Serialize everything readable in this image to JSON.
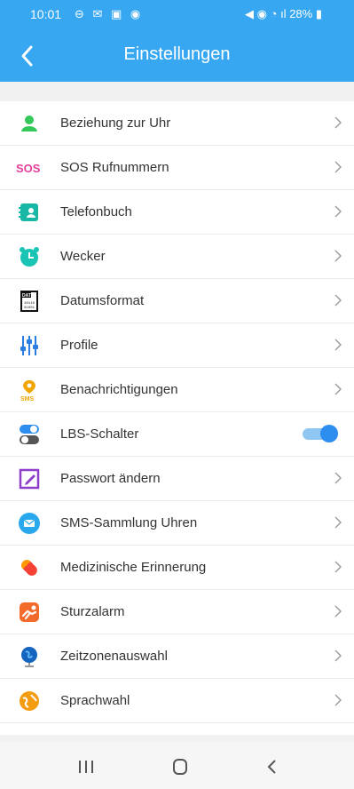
{
  "status": {
    "time": "10:01",
    "left_icons": "⊖ ✉ ▣ ◉",
    "right_icons": "◀ ◉ ◔ ıl",
    "battery": "28%"
  },
  "header": {
    "title": "Einstellungen",
    "back_icon": "back-arrow-icon"
  },
  "settings": [
    {
      "label": "Beziehung zur Uhr",
      "icon": "person-icon",
      "accent": "#34c759"
    },
    {
      "label": "SOS Rufnummern",
      "icon": "sos-icon",
      "accent": "#e53f9c",
      "icon_text": "SOS"
    },
    {
      "label": "Telefonbuch",
      "icon": "contacts-icon",
      "accent": "#19b8a6"
    },
    {
      "label": "Wecker",
      "icon": "alarm-clock-icon",
      "accent": "#19c4b4"
    },
    {
      "label": "Datumsformat",
      "icon": "date-format-icon",
      "accent": "#111111",
      "icon_text": "DAT"
    },
    {
      "label": "Profile",
      "icon": "equalizer-icon",
      "accent": "#2a7de1"
    },
    {
      "label": "Benachrichtigungen",
      "icon": "sms-location-icon",
      "accent": "#f0a500",
      "icon_text": "SMS"
    },
    {
      "label": "LBS-Schalter",
      "icon": "switch-icon",
      "accent": "#2d8ef0",
      "toggle_on": true
    },
    {
      "label": "Passwort ändern",
      "icon": "edit-icon",
      "accent": "#8e3ec9"
    },
    {
      "label": "SMS-Sammlung Uhren",
      "icon": "sms-mail-icon",
      "accent": "#2aa8ee"
    },
    {
      "label": "Medizinische Erinnerung",
      "icon": "pill-icon",
      "accent": "#f44336"
    },
    {
      "label": "Sturzalarm",
      "icon": "fall-alarm-icon",
      "accent": "#f36b2b"
    },
    {
      "label": "Zeitzonenauswahl",
      "icon": "globe-icon",
      "accent": "#1565c0"
    },
    {
      "label": "Sprachwahl",
      "icon": "language-icon",
      "accent": "#f39c12"
    }
  ],
  "navbar": {
    "recent_icon": "recent-apps-icon",
    "home_icon": "home-icon",
    "back_icon": "back-icon"
  }
}
